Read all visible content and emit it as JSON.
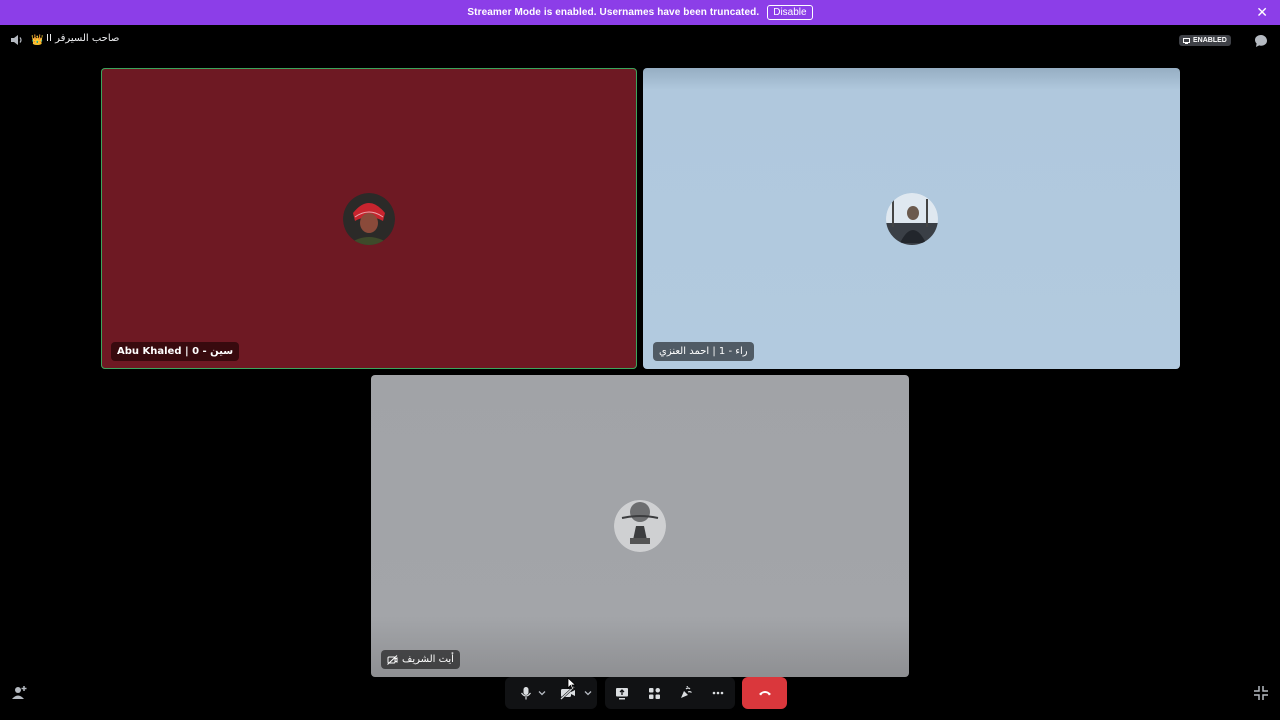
{
  "colors": {
    "banner_bg": "#8c3ee8",
    "background": "#000000",
    "speaking_border": "#3ba55c",
    "hangup": "#da373c",
    "tile_red": "#6e1923",
    "tile_blue": "#b0c8dd",
    "tile_gray": "#a1a3a7"
  },
  "banner": {
    "message": "Streamer Mode is enabled. Usernames have been truncated.",
    "disable_label": "Disable",
    "close_icon": "close-icon"
  },
  "header": {
    "speaker_icon": "speaker-icon",
    "channel_name": "صاحب السيرفر II",
    "crown_emoji": "👑",
    "streamer_badge": "ENABLED",
    "chat_icon": "chat-bubble-icon"
  },
  "tiles": [
    {
      "name": "Abu Khaled | 0 - سين",
      "speaking": true
    },
    {
      "name": "راء - 1 | احمد العنزي",
      "speaking": false
    },
    {
      "name": "أيت الشريف",
      "video_off_icon": "camera-off-icon"
    }
  ],
  "controls": {
    "mic_icon": "microphone-icon",
    "camera_icon": "camera-off-icon",
    "screen_share_icon": "screen-share-icon",
    "activities_icon": "activities-icon",
    "soundboard_icon": "soundboard-icon",
    "more_icon": "more-options-icon",
    "hangup_icon": "hang-up-icon"
  },
  "corners": {
    "invite_icon": "add-person-icon",
    "fullscreen_icon": "exit-fullscreen-icon"
  }
}
